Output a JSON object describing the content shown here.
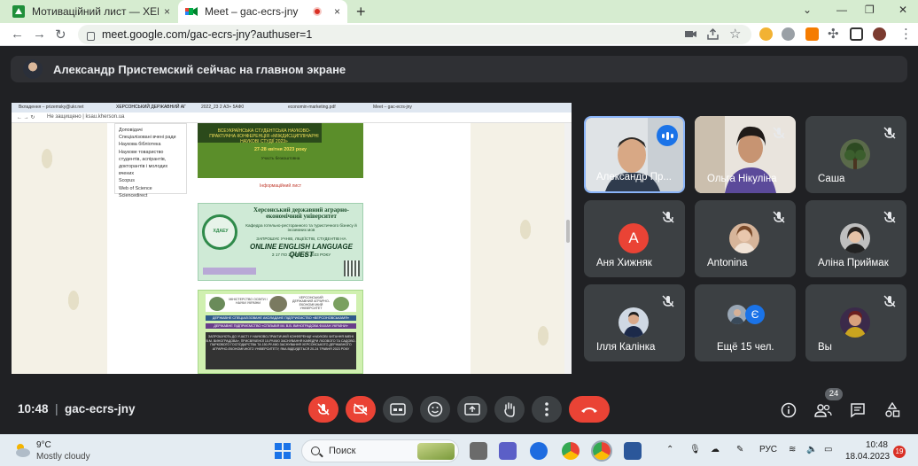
{
  "browser": {
    "tabs": [
      {
        "title": "Мотиваційний лист — ХЕРСОНС",
        "close": "×",
        "active": false
      },
      {
        "title": "Meet – gac-ecrs-jny",
        "close": "×",
        "active": true
      }
    ],
    "new_tab": "+",
    "window_controls": {
      "minimize": "⌄",
      "restore": "—",
      "max": "❐",
      "close": "✕"
    },
    "url": "meet.google.com/gac-ecrs-jny?authuser=1",
    "nav": {
      "back": "←",
      "forward": "→",
      "reload": "↻"
    }
  },
  "meet": {
    "presenter_banner": "Александр Пристемский сейчас на главном экране",
    "meeting_code": "gac-ecrs-jny",
    "time": "10:48",
    "participants_count": "24",
    "colors": {
      "accent": "#8ab4f8",
      "end_call": "#ea4335",
      "bg": "#202124",
      "tile": "#3c4043"
    }
  },
  "shared_screen": {
    "tabs": [
      "Вкладення – prizemsky@ukr.net",
      "ХЕРСОНСЬКИЙ ДЕРЖАВНИЙ АГ",
      "2022_23 2 АЗ+ 5АФ0",
      "economin-marketing.pdf",
      "Meet – gac-ecrs-jny"
    ],
    "address": "Не защищено | ksau.kherson.ua",
    "menu": [
      "Доповідачі",
      "Спеціалізовані вчені ради",
      "Наукова бібліотека",
      "Наукове товариство",
      "студентів, аспірантів,",
      "докторантів і молодих",
      "вчених",
      "Scopus",
      "Web of Science",
      "Sciencedirect"
    ],
    "banner": {
      "subtitle": "ВСЕУКРАЇНСЬКА СТУДЕНТСЬКА НАУКОВО-ПРАКТИЧНА КОНФЕРЕНЦІЯ «МІЖДИСЦИПЛІНАРНІ НАУКОВІ СТУДІЇ 2023»",
      "dates": "27-28 квітня 2023 року",
      "note": "Участь безкоштовна"
    },
    "info_letter": "Інформаційний лист",
    "poster": {
      "univ": "Херсонський державний аграрно-економічний університет",
      "dept": "Кафедра готельно-ресторанного та туристичного бізнесу й іноземних мов",
      "invite": "ЗАПРОШУЄ УЧНІВ, ЛІЦЕЇСТІВ, СТУДЕНТІВ НА",
      "quest": "ONLINE ENGLISH LANGUAGE QUEST",
      "date": "З 17 ПО 21 КВІТНЯ 2023 РОКУ",
      "logo": "ХДАЕУ"
    },
    "leaflet": {
      "org1": "МІНІСТЕРСТВО ОСВІТИ І НАУКИ УКРАЇНИ",
      "org2": "ХЕРСОНСЬКИЙ ДЕРЖАВНИЙ АГРАРНО-ЕКОНОМІЧНИЙ УНІВЕРСИТЕТ",
      "band1": "ДЕРЖАВНЕ СПЕЦІАЛІЗОВАНЕ АКОЛАДАНЕ ПІДПРИЄМСТВО «ВЕРСОНОВСЬКАМЯ»",
      "band2": "ДЕРЖАВНЕ ПІДПРИЄМСТВО «СПІЛЬВІЯ ІМ. В.В. ВИНОГРАДОВА ФАХАН УКРАЇНИ»",
      "body": "ЗАПРОШУЮТЬ ДО УЧАСТІ У НАУКОВО-ПРАКТИЧНІЙ КОНФЕРЕНЦІЇ «НАУКОВІ ЧИТАННЯ ІМЕНІ В.М. ВИНОГРАДОВА», ПРИСВЯЧЕНОЇ 10-РІЧЧЮ ЗАСНУВАННЯ КАФЕДРИ ЛІСОВОГО ТА САДОВО-ПАРКОВОГО ГОСПОДАРСТВА ТА 150-РІЧЧЮ ЗАСНУВАННЯ ХЕРСОНСЬКОГО ДЕРЖАВНОГО АГРАРНО-ЕКОНОМІЧНОГО УНІВЕРСИТЕТУ, ЯКА ВІДБУДЕТЬСЯ 20-24 ТРАВНЯ 2023 РОКУ"
    }
  },
  "participants": [
    {
      "name": "Александр Пр...",
      "kind": "video-man",
      "speaking": true
    },
    {
      "name": "Ольга Нікуліна",
      "kind": "video-woman",
      "muted": true
    },
    {
      "name": "Саша",
      "kind": "avatar-tree",
      "muted": true
    },
    {
      "name": "Аня Хижняк",
      "kind": "letter",
      "letter": "А",
      "color": "#ea4335",
      "muted": true
    },
    {
      "name": "Antonina",
      "kind": "avatar-photo-a",
      "muted": true
    },
    {
      "name": "Аліна Приймак",
      "kind": "avatar-photo-b",
      "muted": true
    },
    {
      "name": "Ілля Калінка",
      "kind": "avatar-photo-c",
      "muted": true
    },
    {
      "name": "Ещё 15 чел.",
      "kind": "more",
      "letter": "Є"
    },
    {
      "name": "Вы",
      "kind": "avatar-photo-d",
      "muted": true
    }
  ],
  "controls": [
    "mic-off",
    "camera-off",
    "captions",
    "emoji",
    "present",
    "raise-hand",
    "more",
    "end-call"
  ],
  "right_controls": [
    "info",
    "people",
    "chat",
    "activities"
  ],
  "taskbar": {
    "temp": "9°C",
    "condition": "Mostly cloudy",
    "search": "Поиск",
    "lang": "РУС",
    "time": "10:48",
    "date": "18.04.2023",
    "notifications": "19"
  }
}
